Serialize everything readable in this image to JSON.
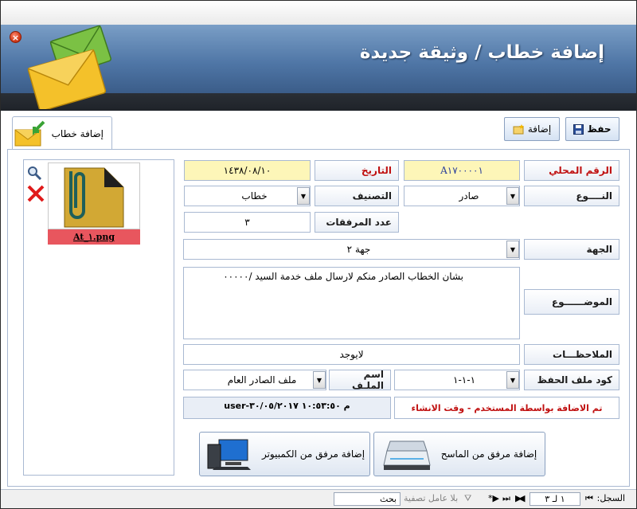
{
  "window": {
    "title": "إضافة خطاب / وثيقة جديدة",
    "close_icon": "close-icon"
  },
  "toolbar": {
    "save_label": "حفظ",
    "add_label": "إضافة"
  },
  "tab": {
    "label": "إضافة خطاب"
  },
  "attachment": {
    "file_name": "At_١.png"
  },
  "form": {
    "local_number_label": "الرقم المحلي",
    "local_number": "A١٧٠٠٠٠١",
    "date_label": "التاريخ",
    "date": "١٤٣٨/٠٨/١٠",
    "type_label": "النــــوع",
    "type_value": "صادر",
    "classification_label": "التصنيف",
    "classification_value": "خطاب",
    "attachments_count_label": "عدد المرفقات",
    "attachments_count": "٣",
    "entity_label": "الجهة",
    "entity_value": "جهة ٢",
    "subject_label": "الموضــــــوع",
    "subject_value": "بشان الخطاب الصادر منكم لارسال ملف خدمة السيد /٠٠٠٠٠",
    "notes_label": "الملاحظـــات",
    "notes_value": "لايوجد",
    "file_code_label": "كود ملف الحفظ",
    "file_code_value": "١-١-١",
    "file_name_label": "اسم الملـف",
    "file_name_value": "ملف الصادر العام",
    "created_by_label": "تم الاضافة بواسطة المستخدم - وقت الانشاء",
    "created_by_value": "user-م ١٠:٥٣:٥٠ ٣٠/٠٥/٢٠١٧"
  },
  "actions": {
    "scan_label": "إضافة مرفق من الماسح",
    "computer_label": "إضافة مرفق من الكمبيوتر"
  },
  "navigator": {
    "record_label": "السجل:",
    "record_position": "١ لـ ٣",
    "filter_label": "بلا عامل تصفية",
    "search_label": "بحث"
  },
  "colors": {
    "header": "#4f76a6",
    "highlight_yellow": "#fdf6b8",
    "attachment_red": "#e8565e",
    "label_red": "#c01010"
  }
}
